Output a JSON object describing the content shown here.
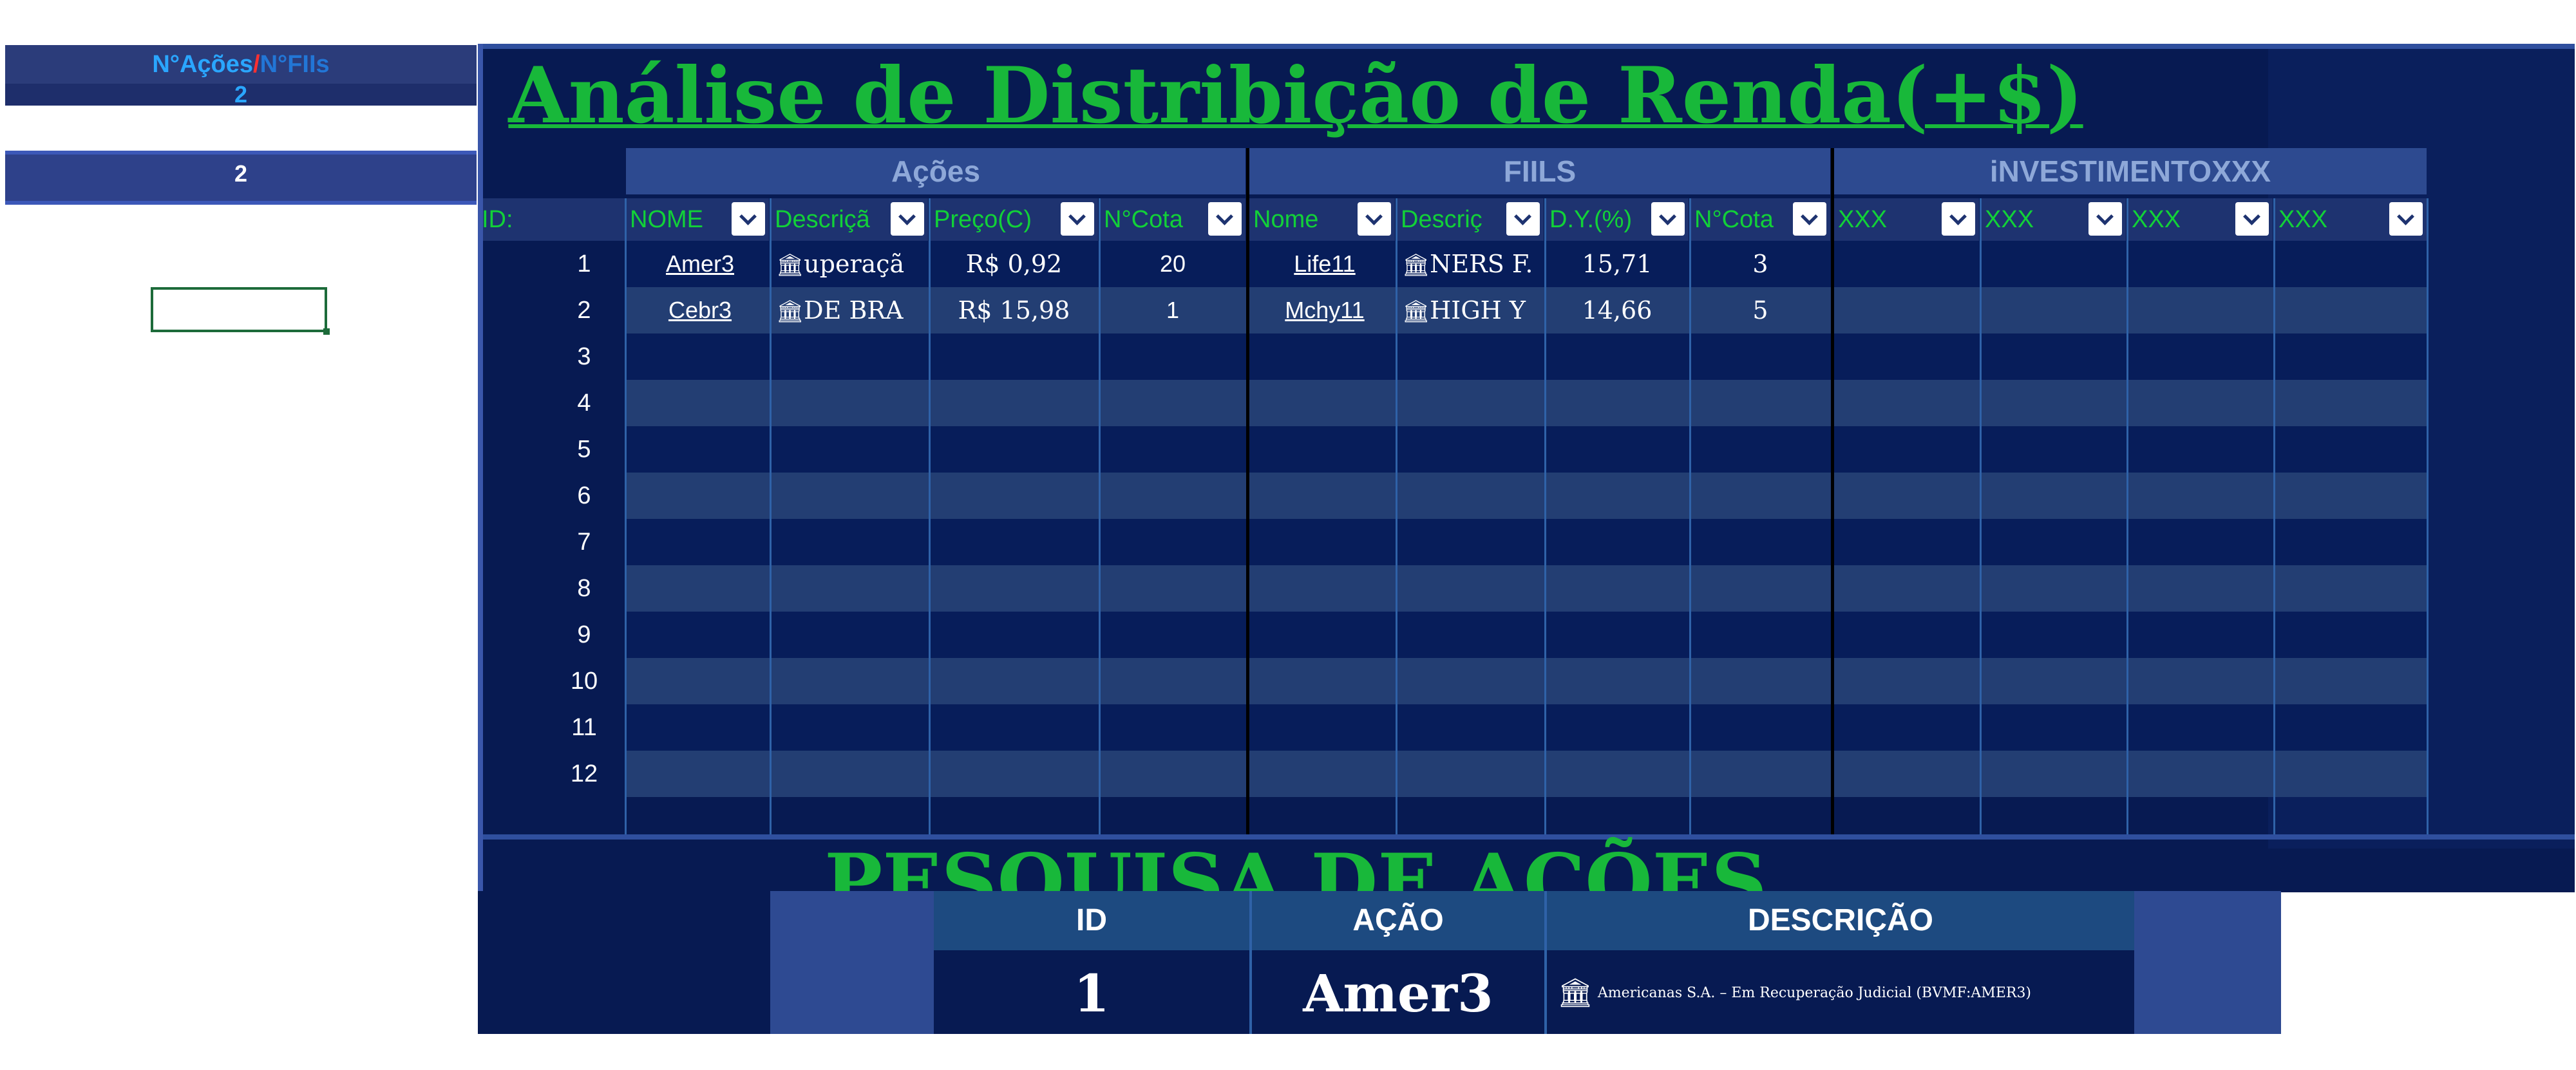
{
  "summary": {
    "header_acoes": "N°Ações",
    "header_sep": "/",
    "header_fiis": "N°FIIs",
    "count_acoes": "2",
    "count_fiis": "2"
  },
  "main_title": "Análise de Distribição de Renda(+$)",
  "groups": {
    "acoes": "Ações",
    "fiis": "FIILS",
    "investimento": "iNVESTIMENTOXXX"
  },
  "columns": {
    "id": "ID:",
    "nome": "NOME",
    "descricao": "Descriçã",
    "preco": "Preço(C)",
    "ncotas": "N°Cota",
    "fii_nome": "Nome",
    "fii_descricao": "Descriç",
    "dy": "D.Y.(%)",
    "fii_ncotas": "N°Cota",
    "xxx1": "XXX",
    "xxx2": "XXX",
    "xxx3": "XXX",
    "xxx4": "XXX"
  },
  "rows": [
    {
      "id": "1",
      "nome": "Amer3",
      "descricao": "uperaçã",
      "preco": "R$ 0,92",
      "cotas": "20",
      "fii_nome": "Life11",
      "fii_descricao": "NERS F.",
      "dy": "15,71",
      "fii_cotas": "3"
    },
    {
      "id": "2",
      "nome": "Cebr3",
      "descricao": "DE BRA",
      "preco": "R$ 15,98",
      "cotas": "1",
      "fii_nome": "Mchy11",
      "fii_descricao": "HIGH Y",
      "dy": "14,66",
      "fii_cotas": "5"
    },
    {
      "id": "3"
    },
    {
      "id": "4"
    },
    {
      "id": "5"
    },
    {
      "id": "6"
    },
    {
      "id": "7"
    },
    {
      "id": "8"
    },
    {
      "id": "9"
    },
    {
      "id": "10"
    },
    {
      "id": "11"
    },
    {
      "id": "12"
    }
  ],
  "search": {
    "title": "PESQUISA DE AÇÕES",
    "col_id": "ID",
    "col_acao": "AÇÃO",
    "col_descricao": "DESCRIÇÃO",
    "result_id": "1",
    "result_acao": "Amer3",
    "result_descricao": "Americanas S.A. – Em Recuperação Judicial (BVMF:AMER3)"
  },
  "colors": {
    "panel_bg": "#071a52",
    "title_green": "#18b83a",
    "header_green": "#12d138"
  }
}
